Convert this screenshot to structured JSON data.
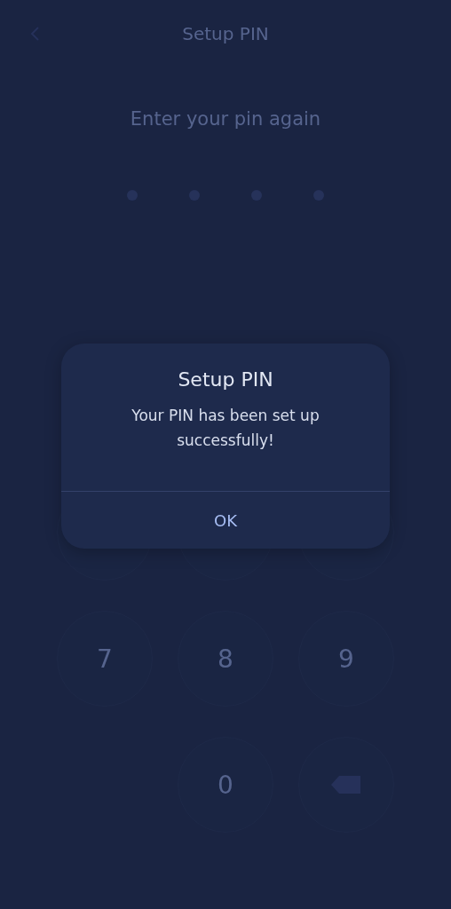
{
  "screen": {
    "title": "Setup PIN",
    "subtitle": "Enter your pin again",
    "pin_dots": [
      {
        "filled": true
      },
      {
        "filled": true
      },
      {
        "filled": true
      },
      {
        "filled": true
      }
    ],
    "keys": [
      {
        "kind": "covered"
      },
      {
        "kind": "covered"
      },
      {
        "kind": "covered"
      },
      {
        "kind": "digit",
        "label": "7"
      },
      {
        "kind": "digit",
        "label": "8"
      },
      {
        "kind": "digit",
        "label": "9"
      },
      {
        "kind": "empty"
      },
      {
        "kind": "digit",
        "label": "0"
      },
      {
        "kind": "backspace"
      }
    ]
  },
  "dialog": {
    "title": "Setup PIN",
    "message": "Your PIN has been set up successfully!",
    "buttons": [
      "OK"
    ]
  }
}
